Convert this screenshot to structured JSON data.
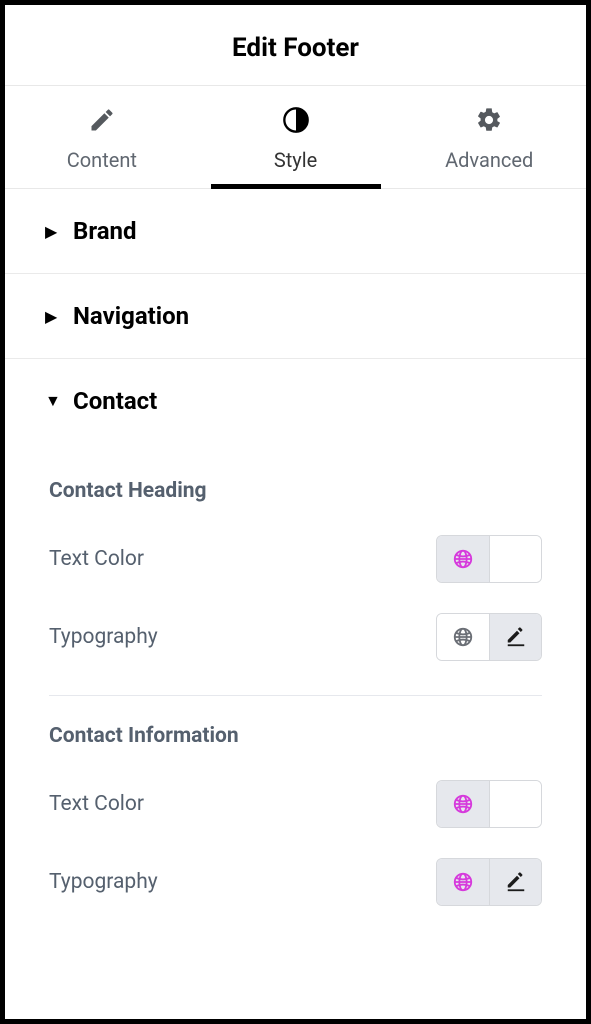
{
  "header": {
    "title": "Edit Footer"
  },
  "tabs": {
    "content": {
      "label": "Content"
    },
    "style": {
      "label": "Style"
    },
    "advanced": {
      "label": "Advanced"
    }
  },
  "sections": {
    "brand": {
      "title": "Brand"
    },
    "navigation": {
      "title": "Navigation"
    },
    "contact": {
      "title": "Contact"
    }
  },
  "contact": {
    "heading": {
      "title": "Contact Heading",
      "text_color": {
        "label": "Text Color"
      },
      "typography": {
        "label": "Typography"
      }
    },
    "info": {
      "title": "Contact Information",
      "text_color": {
        "label": "Text Color"
      },
      "typography": {
        "label": "Typography"
      }
    }
  },
  "colors": {
    "accent": "#d63adc",
    "muted": "#6b6f76"
  }
}
